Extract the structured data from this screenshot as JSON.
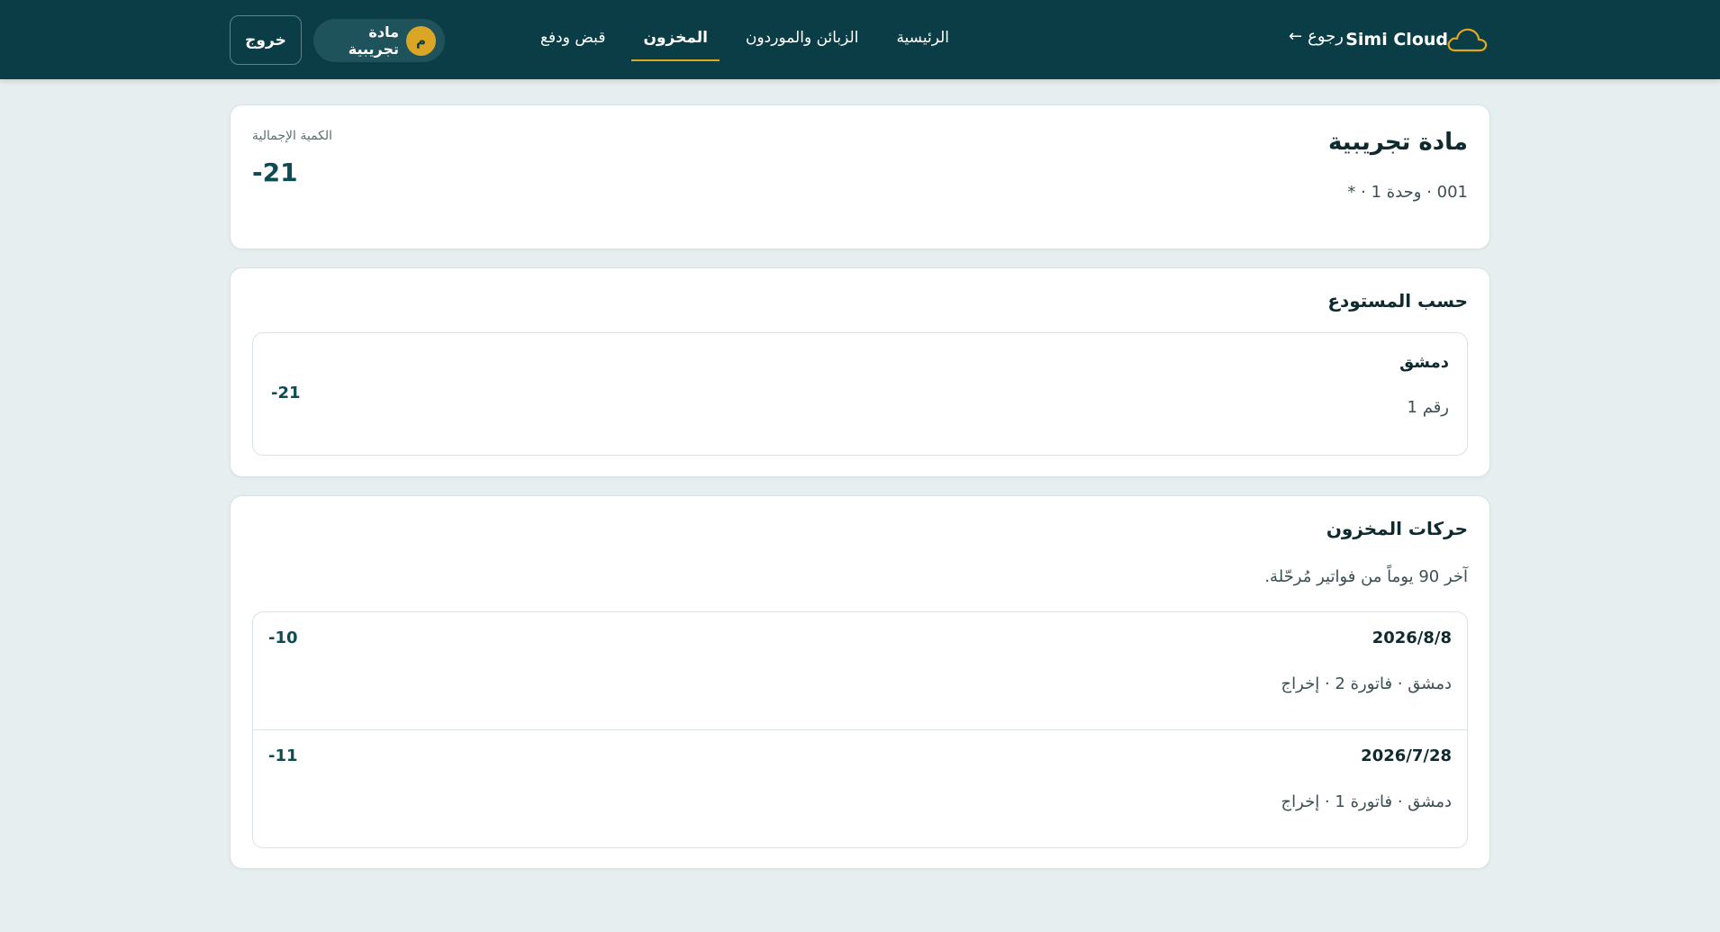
{
  "header": {
    "brand": "Simi Cloud",
    "back_label": "رجوع",
    "back_arrow": "←",
    "nav": [
      {
        "label": "الرئيسية",
        "active": false
      },
      {
        "label": "الزبائن والموردون",
        "active": false
      },
      {
        "label": "المخزون",
        "active": true
      },
      {
        "label": "قبض ودفع",
        "active": false
      }
    ],
    "user": {
      "avatar_letter": "م",
      "name": "مادة تجريبية"
    },
    "logout_label": "خروج",
    "colors": {
      "bar": "#0a3d45",
      "accent": "#e0a81e",
      "avatar": "#dba625"
    }
  },
  "product": {
    "title": "مادة تجريبية",
    "meta": "001 · وحدة 1 · *",
    "total_label": "الكمية الإجمالية",
    "total_value": "-21"
  },
  "warehouses": {
    "title": "حسب المستودع",
    "items": [
      {
        "name": "دمشق",
        "sub": "رقم 1",
        "qty": "-21"
      }
    ]
  },
  "movements": {
    "title": "حركات المخزون",
    "subtitle": "آخر 90 يوماً من فواتير مُرحّلة.",
    "rows": [
      {
        "date": "2026/8/8",
        "detail": "دمشق · فاتورة 2 · إخراج",
        "qty": "-10"
      },
      {
        "date": "2026/7/28",
        "detail": "دمشق · فاتورة 1 · إخراج",
        "qty": "-11"
      }
    ]
  }
}
